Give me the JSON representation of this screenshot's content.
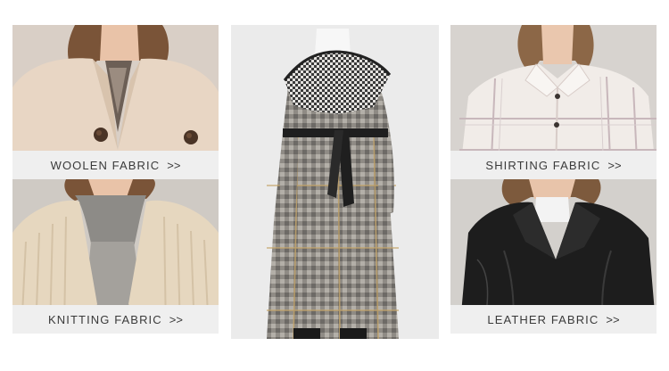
{
  "tiles": {
    "woolen": {
      "label": "WOOLEN FABRIC",
      "arrow": ">>"
    },
    "knitting": {
      "label": "KNITTING FABRIC",
      "arrow": ">>"
    },
    "shirting": {
      "label": "SHIRTING FABRIC",
      "arrow": ">>"
    },
    "leather": {
      "label": "LEATHER FABRIC",
      "arrow": ">>"
    }
  },
  "colors": {
    "label_bg": "#efefef",
    "label_text": "#3a3a3a",
    "camel_coat": "#e8d6c4",
    "knit_cream": "#e6d7bf",
    "check_coat": "#8a8782",
    "shirt_white": "#f1ece8",
    "leather_black": "#1d1d1d"
  }
}
